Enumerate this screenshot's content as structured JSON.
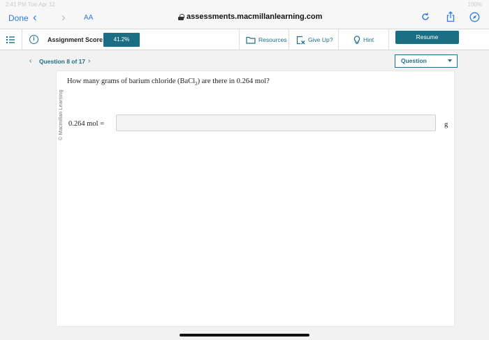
{
  "status_bar": {
    "time": "2:41 PM   Tue Apr 12",
    "right": "100%"
  },
  "browser": {
    "done_label": "Done",
    "back_glyph": "‹",
    "forward_glyph": "›",
    "text_size_label": "AA",
    "url": "assessments.macmillanlearning.com",
    "icons": [
      "lock-icon",
      "reload-icon",
      "share-icon",
      "compass-icon"
    ]
  },
  "toolbar": {
    "menu_icon": "list-icon",
    "score_label": "Assignment Score:",
    "score_value": "41.2%",
    "resources_label": "Resources",
    "give_up_label": "Give Up?",
    "hint_label": "Hint",
    "resume_label": "Resume"
  },
  "question_nav": {
    "prev_glyph": "‹",
    "label": "Question 8 of 17",
    "next_glyph": "›",
    "select_value": "Question"
  },
  "question": {
    "copyright": "© Macmillan Learning",
    "text_before": "How many grams of barium chloride (BaCl",
    "subscript": "2",
    "text_after": ") are there in 0.264 mol?",
    "answer_label": "0.264 mol =",
    "answer_value": "",
    "unit": "g"
  },
  "colors": {
    "accent": "#1b6f85",
    "safari_blue": "#2a7ae2",
    "background": "#f2f2f2"
  }
}
